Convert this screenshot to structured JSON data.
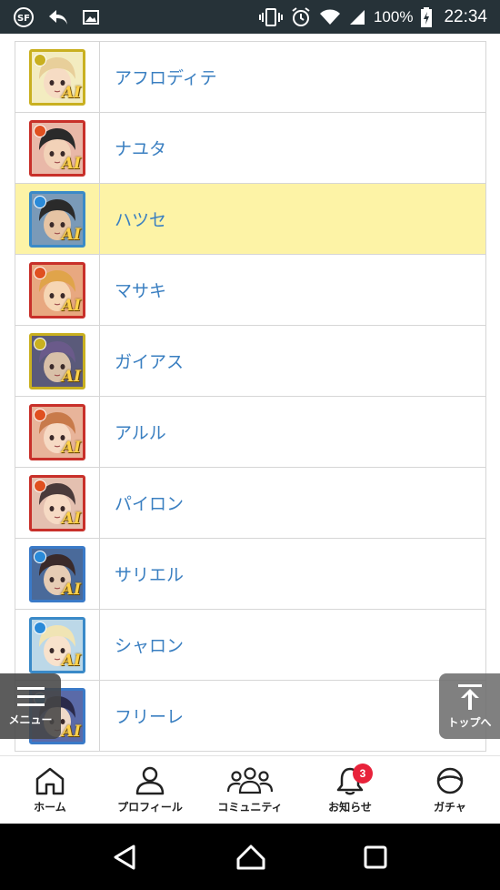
{
  "status_bar": {
    "battery_percent": "100%",
    "time": "22:34"
  },
  "characters": [
    {
      "name": "アフロディテ",
      "element_color": "#c9b020",
      "frame_color": "#c9b020",
      "skin": "#f6dcc4",
      "hair": "#e8cf9a",
      "bg": "#f3ecc0",
      "highlighted": false
    },
    {
      "name": "ナユタ",
      "element_color": "#e05020",
      "frame_color": "#c8302a",
      "skin": "#f2d2b8",
      "hair": "#2a2a2a",
      "bg": "#e9b8a8",
      "highlighted": false
    },
    {
      "name": "ハツセ",
      "element_color": "#2a8ad8",
      "frame_color": "#3a8ac8",
      "skin": "#e6c4a4",
      "hair": "#2a2a2a",
      "bg": "#7a9ab8",
      "highlighted": true
    },
    {
      "name": "マサキ",
      "element_color": "#e05020",
      "frame_color": "#c8302a",
      "skin": "#f6d6b4",
      "hair": "#e0a44a",
      "bg": "#e8a880",
      "highlighted": false
    },
    {
      "name": "ガイアス",
      "element_color": "#c9b020",
      "frame_color": "#c9b020",
      "skin": "#d8c0a8",
      "hair": "#6a5a8a",
      "bg": "#5a5a7a",
      "highlighted": false
    },
    {
      "name": "アルル",
      "element_color": "#e05020",
      "frame_color": "#c8302a",
      "skin": "#f6dac4",
      "hair": "#c87a4a",
      "bg": "#e8b49a",
      "highlighted": false
    },
    {
      "name": "パイロン",
      "element_color": "#e05020",
      "frame_color": "#c8302a",
      "skin": "#f6dac4",
      "hair": "#4a3a3a",
      "bg": "#e4c0b0",
      "highlighted": false
    },
    {
      "name": "サリエル",
      "element_color": "#2a8ad8",
      "frame_color": "#3a7ac8",
      "skin": "#e6ccb4",
      "hair": "#3a2a2a",
      "bg": "#4a6a9a",
      "highlighted": false
    },
    {
      "name": "シャロン",
      "element_color": "#2a8ad8",
      "frame_color": "#3a8ac8",
      "skin": "#f8e2cc",
      "hair": "#f0e4b4",
      "bg": "#bcd8e8",
      "highlighted": false
    },
    {
      "name": "フリーレ",
      "element_color": "#2a8ad8",
      "frame_color": "#3a7ac8",
      "skin": "#f0dac8",
      "hair": "#2a2a4a",
      "bg": "#5a6aa8",
      "highlighted": false
    }
  ],
  "floating": {
    "menu_label": "メニュー",
    "top_label": "トップへ"
  },
  "bottom_nav": {
    "items": [
      {
        "label": "ホーム",
        "icon": "home-icon"
      },
      {
        "label": "プロフィール",
        "icon": "person-icon"
      },
      {
        "label": "コミュニティ",
        "icon": "group-icon"
      },
      {
        "label": "お知らせ",
        "icon": "bell-icon"
      },
      {
        "label": "ガチャ",
        "icon": "gacha-icon"
      }
    ],
    "notification_count": "3"
  }
}
